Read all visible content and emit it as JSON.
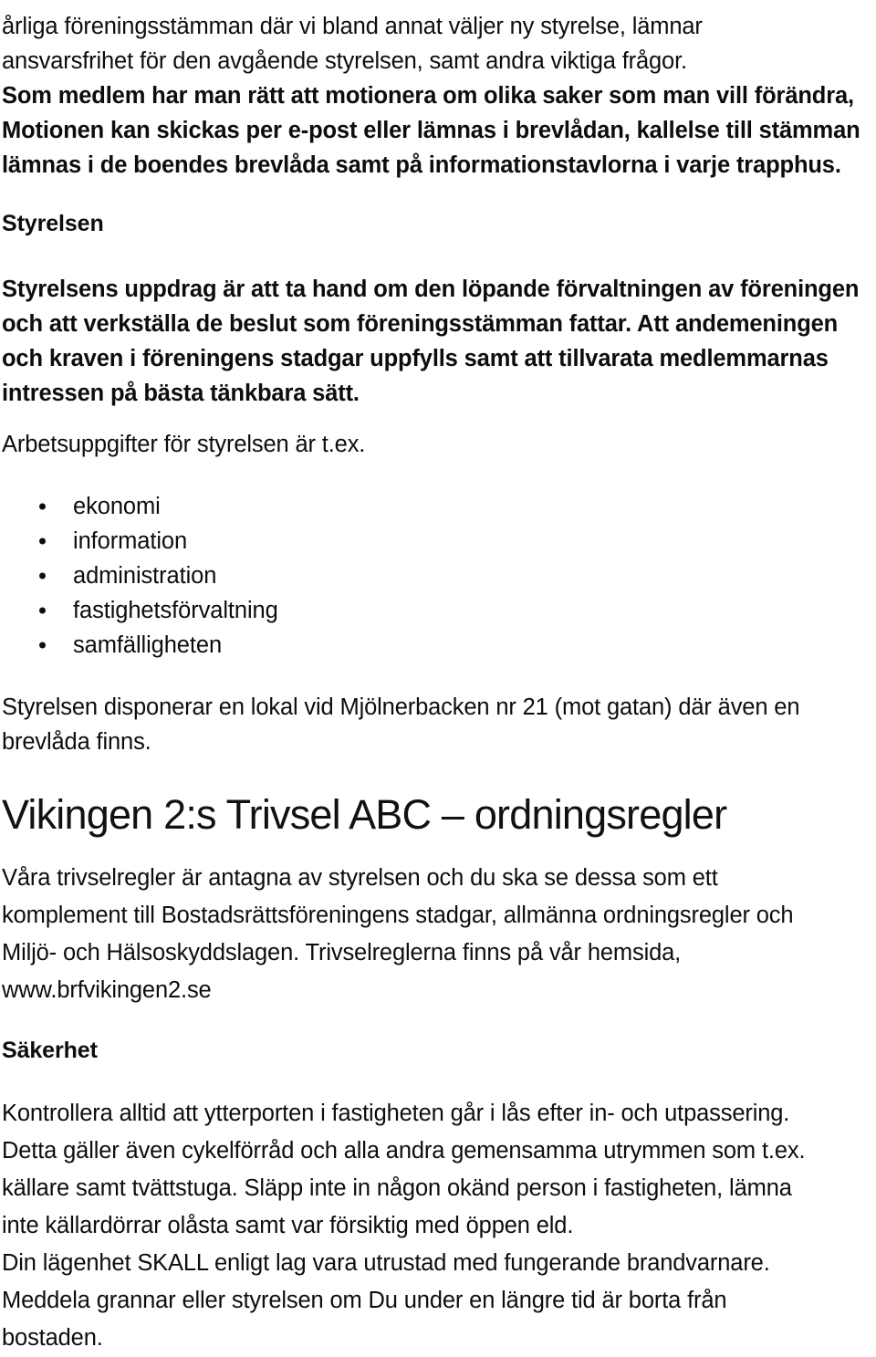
{
  "document": {
    "intro_paragraph": {
      "lines": [
        "årliga föreningsstämman där vi bland annat väljer ny styrelse, lämnar",
        "ansvarsfrihet för den avgående styrelsen, samt andra viktiga frågor."
      ]
    },
    "motion_paragraph": {
      "lines": [
        "Som medlem har man rätt att motionera om olika saker som man vill förändra,",
        "Motionen kan skickas per e-post eller lämnas i brevlådan, kallelse till stämman",
        "lämnas i de boendes brevlåda samt på informationstavlorna i varje trapphus."
      ]
    },
    "board_heading": "Styrelsen",
    "board_paragraph": {
      "lines": [
        "Styrelsens uppdrag är att ta hand om den löpande förvaltningen av föreningen",
        "och att verkställa de beslut som föreningsstämman fattar. Att andemeningen",
        "och kraven i föreningens stadgar uppfylls samt att tillvarata medlemmarnas",
        "intressen på bästa tänkbara sätt."
      ]
    },
    "tasks_intro": "Arbetsuppgifter för styrelsen är t.ex.",
    "tasks_list": [
      "ekonomi",
      "information",
      "administration",
      "fastighetsförvaltning",
      "samfälligheten"
    ],
    "premises_paragraph": {
      "lines": [
        "Styrelsen disponerar en lokal vid Mjölnerbacken nr 21 (mot gatan) där även en",
        "brevlåda finns."
      ]
    },
    "main_title": "Vikingen 2:s Trivsel ABC – ordningsregler",
    "rules_paragraph": {
      "lines": [
        "Våra trivselregler är antagna av styrelsen och du ska se dessa som ett",
        "komplement till Bostadsrättsföreningens stadgar, allmänna ordningsregler och",
        "Miljö- och Hälsoskyddslagen. Trivselreglerna finns på vår hemsida,",
        "www.brfvikingen2.se"
      ]
    },
    "safety_heading": "Säkerhet",
    "safety_paragraph": {
      "lines": [
        "Kontrollera alltid att ytterporten i fastigheten går i lås efter in- och utpassering.",
        "Detta gäller även cykelförråd och alla andra gemensamma utrymmen som t.ex.",
        "källare samt tvättstuga. Släpp inte in någon okänd person i fastigheten, lämna",
        "inte källardörrar olåsta samt var försiktig med öppen eld.",
        "Din lägenhet SKALL enligt lag vara utrustad med fungerande brandvarnare.",
        "Meddela grannar eller styrelsen om Du under en längre tid är borta från",
        "bostaden."
      ]
    },
    "colors": {
      "text": "#0d0d0d",
      "background": "#ffffff"
    }
  }
}
